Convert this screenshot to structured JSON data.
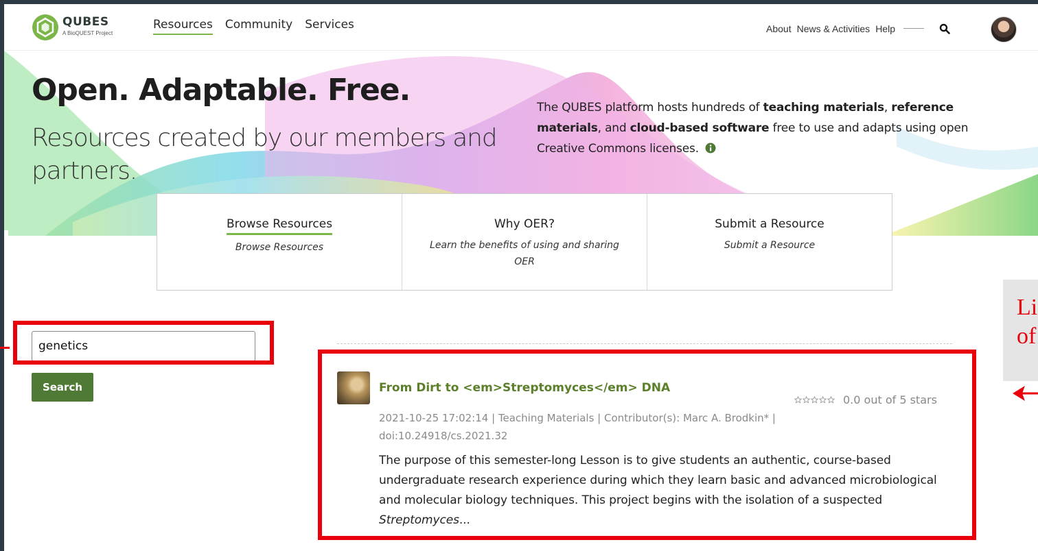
{
  "header": {
    "logo": {
      "name": "QUBES",
      "subtitle": "A BioQUEST Project"
    },
    "main_nav": [
      "Resources",
      "Community",
      "Services"
    ],
    "util_nav": [
      "About",
      "News & Activities",
      "Help"
    ]
  },
  "hero": {
    "title": "Open. Adaptable. Free.",
    "subtitle": "Resources created by our members and partners.",
    "description": {
      "p1": "The QUBES platform hosts hundreds of ",
      "b1": "teaching materials",
      "p2": ", ",
      "b2": "reference materials",
      "p3": ", and ",
      "b3": "cloud-based software",
      "p4": " free to use and adapts using open Creative Commons licenses."
    }
  },
  "cards": [
    {
      "title": "Browse Resources",
      "sub": "Browse Resources"
    },
    {
      "title": "Why OER?",
      "sub": "Learn the benefits of using and sharing OER"
    },
    {
      "title": "Submit a Resource",
      "sub": "Submit a Resource"
    }
  ],
  "search": {
    "value": "genetics",
    "button": "Search"
  },
  "result": {
    "title": "From Dirt to <em>Streptomyces</em> DNA",
    "rating_value": 0.0,
    "rating_text": "0.0 out of 5 stars",
    "meta": "2021-10-25 17:02:14   |   Teaching Materials   |   Contributor(s): Marc A. Brodkin*   |   doi:10.24918/cs.2021.32",
    "desc_main": "The purpose of this semester-long Lesson is to give students an authentic, course-based undergraduate research experience during which they learn basic and advanced microbiological and molecular biology techniques. This project begins with the isolation of a suspected ",
    "desc_em": "Streptomyces",
    "desc_end": "..."
  },
  "annotation": {
    "callout_line1": "Li",
    "callout_line2": "of",
    "color": "#e8000b"
  },
  "colors": {
    "accent": "#7ab648",
    "button": "#4f7a35",
    "link": "#5b7f2a"
  },
  "icons": [
    "qubes-logo-icon",
    "search-icon",
    "info-icon",
    "star-outline-icon",
    "red-arrow-icon"
  ]
}
